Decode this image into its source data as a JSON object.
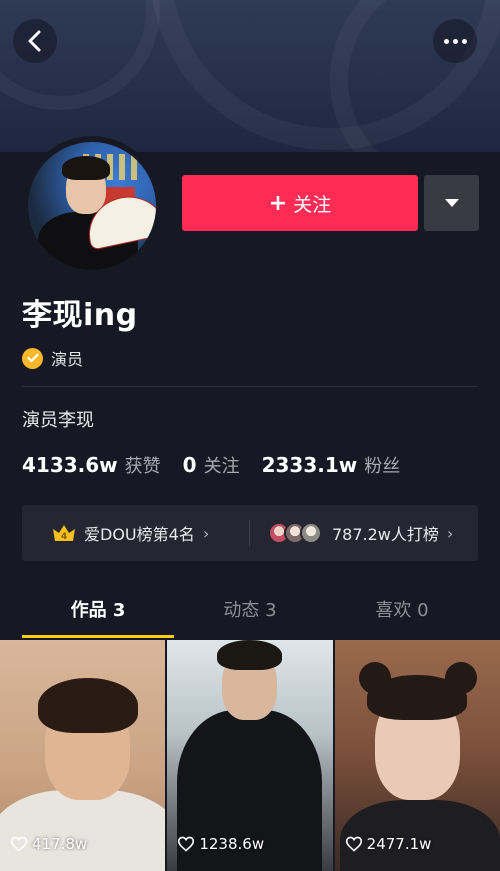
{
  "header": {
    "back_icon": "chevron-left-icon",
    "more_icon": "more-dots-icon"
  },
  "profile": {
    "follow_label": "关注",
    "follow_icon": "plus-icon",
    "dropdown_icon": "triangle-down-icon",
    "nickname": "李现ing",
    "verified_label": "演员",
    "bio": "演员李现",
    "stats": [
      {
        "value": "4133.6w",
        "label": "获赞"
      },
      {
        "value": "0",
        "label": "关注"
      },
      {
        "value": "2333.1w",
        "label": "粉丝"
      }
    ],
    "rank": {
      "crown_number": "4",
      "text": "爱DOU榜第4名",
      "supporters_text": "787.2w人打榜"
    }
  },
  "tabs": [
    {
      "label": "作品 3",
      "active": true
    },
    {
      "label": "动态 3",
      "active": false
    },
    {
      "label": "喜欢 0",
      "active": false
    }
  ],
  "videos": [
    {
      "likes": "417.8w"
    },
    {
      "likes": "1238.6w"
    },
    {
      "likes": "2477.1w"
    }
  ],
  "colors": {
    "background": "#161823",
    "follow": "#fe2c55",
    "tab_indicator": "#face15",
    "verified": "#f8b82a"
  }
}
